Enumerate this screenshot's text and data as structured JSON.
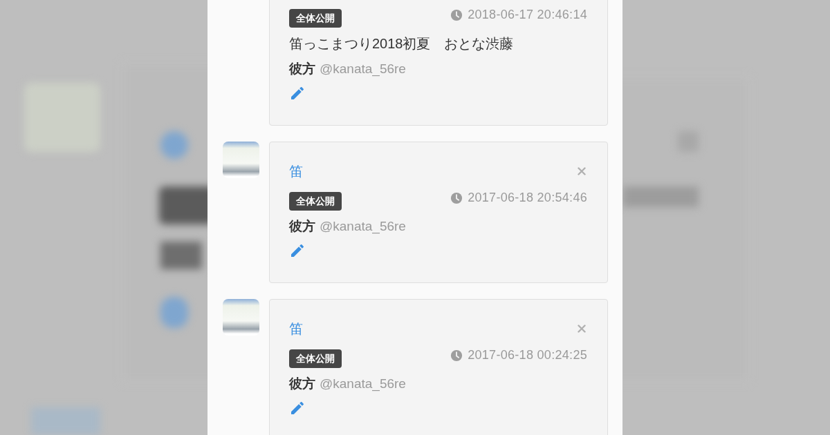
{
  "posts": [
    {
      "avatar": false,
      "closable": false,
      "visibility": "全体公開",
      "datetime": "2018-06-17 20:46:14",
      "body": "笛っこまつり2018初夏　おとな渋藤",
      "author": "彼方",
      "handle": "@kanata_56re"
    },
    {
      "avatar": true,
      "title": "笛",
      "closable": true,
      "visibility": "全体公開",
      "datetime": "2017-06-18 20:54:46",
      "author": "彼方",
      "handle": "@kanata_56re"
    },
    {
      "avatar": true,
      "title": "笛",
      "closable": true,
      "visibility": "全体公開",
      "datetime": "2017-06-18 00:24:25",
      "author": "彼方",
      "handle": "@kanata_56re"
    }
  ]
}
